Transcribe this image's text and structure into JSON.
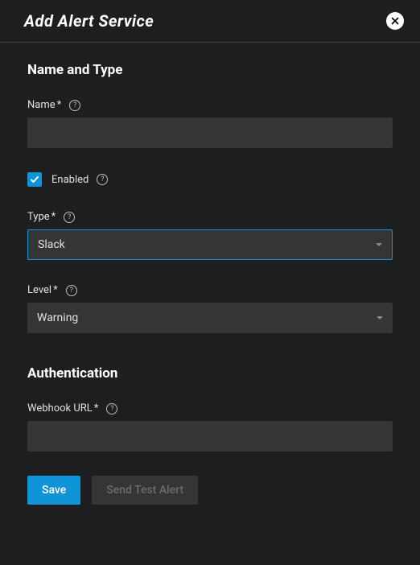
{
  "dialog": {
    "title": "Add Alert Service"
  },
  "sections": {
    "nameType": {
      "title": "Name and Type"
    },
    "auth": {
      "title": "Authentication"
    }
  },
  "fields": {
    "name": {
      "label": "Name",
      "required": "*",
      "value": ""
    },
    "enabled": {
      "label": "Enabled",
      "checked": true
    },
    "type": {
      "label": "Type",
      "required": "*",
      "value": "Slack"
    },
    "level": {
      "label": "Level",
      "required": "*",
      "value": "Warning"
    },
    "webhook": {
      "label": "Webhook URL",
      "required": "*",
      "value": ""
    }
  },
  "actions": {
    "save": "Save",
    "sendTest": "Send Test Alert"
  },
  "help": "?"
}
